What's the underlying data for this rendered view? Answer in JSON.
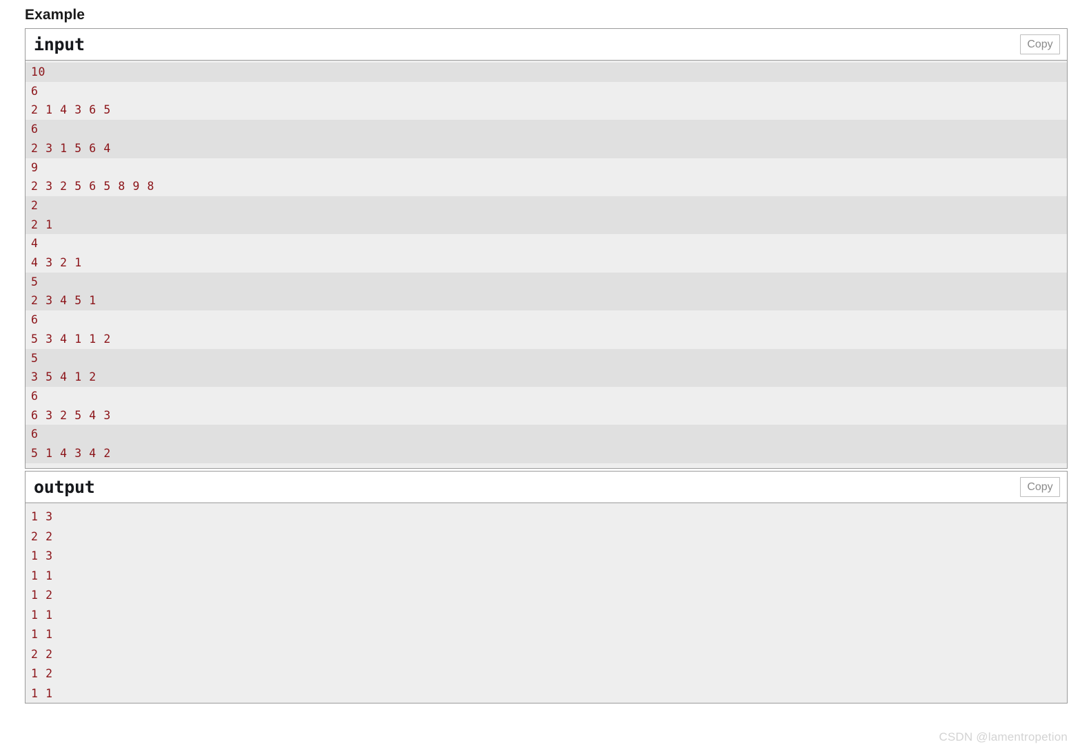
{
  "page": {
    "heading": "Example",
    "watermark": "CSDN @lamentropetion"
  },
  "input_block": {
    "title": "input",
    "copy_label": "Copy",
    "lines": [
      "10",
      "6",
      "2 1 4 3 6 5",
      "6",
      "2 3 1 5 6 4",
      "9",
      "2 3 2 5 6 5 8 9 8",
      "2",
      "2 1",
      "4",
      "4 3 2 1",
      "5",
      "2 3 4 5 1",
      "6",
      "5 3 4 1 1 2",
      "5",
      "3 5 4 1 2",
      "6",
      "6 3 2 5 4 3",
      "6",
      "5 1 4 3 4 2"
    ],
    "zebra_groups": [
      [
        0
      ],
      [
        3,
        4
      ],
      [
        7,
        8
      ],
      [
        11,
        12
      ],
      [
        15,
        16
      ],
      [
        19,
        20
      ]
    ]
  },
  "output_block": {
    "title": "output",
    "copy_label": "Copy",
    "lines": [
      "1 3",
      "2 2",
      "1 3",
      "1 1",
      "1 2",
      "1 1",
      "1 1",
      "2 2",
      "1 2",
      "1 1"
    ]
  },
  "colors": {
    "code_text": "#8b1318",
    "zebra_row": "#e0e0e0",
    "body_bg": "#eeeeee",
    "border": "#9a9a9a",
    "watermark": "#d3d3d3"
  }
}
